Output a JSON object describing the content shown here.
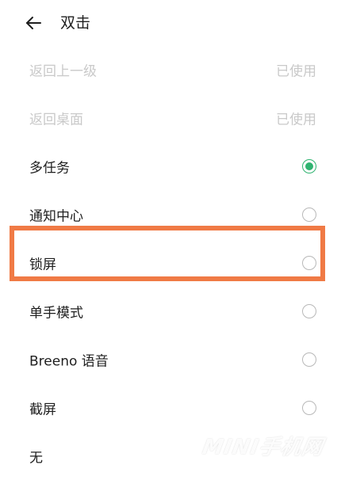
{
  "header": {
    "title": "双击"
  },
  "options": [
    {
      "label": "返回上一级",
      "status": "已使用",
      "state": "disabled"
    },
    {
      "label": "返回桌面",
      "status": "已使用",
      "state": "disabled"
    },
    {
      "label": "多任务",
      "status": "",
      "state": "checked"
    },
    {
      "label": "通知中心",
      "status": "",
      "state": "unchecked"
    },
    {
      "label": "锁屏",
      "status": "",
      "state": "unchecked"
    },
    {
      "label": "单手模式",
      "status": "",
      "state": "unchecked"
    },
    {
      "label": "Breeno 语音",
      "status": "",
      "state": "unchecked"
    },
    {
      "label": "截屏",
      "status": "",
      "state": "unchecked"
    },
    {
      "label": "无",
      "status": "",
      "state": "unchecked"
    }
  ],
  "colors": {
    "accent": "#2fb370",
    "highlight": "#f07a45",
    "disabled_text": "#c9c9c9"
  },
  "icons": {
    "back": "arrow-left-icon"
  },
  "watermark": {
    "text": "MINI手机网"
  }
}
